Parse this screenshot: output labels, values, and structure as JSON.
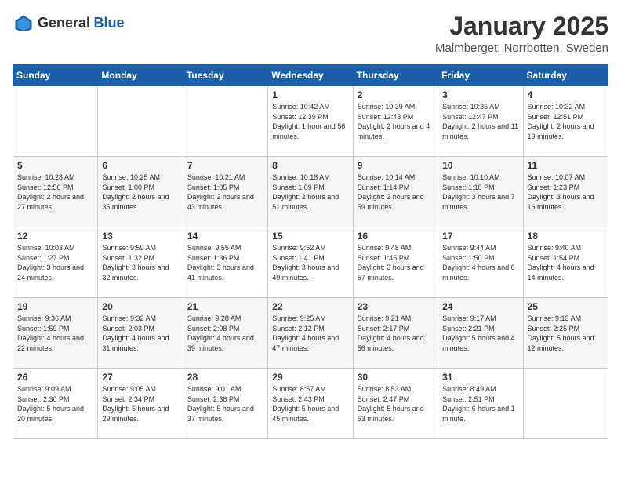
{
  "header": {
    "logo_general": "General",
    "logo_blue": "Blue",
    "title": "January 2025",
    "subtitle": "Malmberget, Norrbotten, Sweden"
  },
  "weekdays": [
    "Sunday",
    "Monday",
    "Tuesday",
    "Wednesday",
    "Thursday",
    "Friday",
    "Saturday"
  ],
  "weeks": [
    [
      {
        "day": "",
        "content": ""
      },
      {
        "day": "",
        "content": ""
      },
      {
        "day": "",
        "content": ""
      },
      {
        "day": "1",
        "content": "Sunrise: 10:42 AM\nSunset: 12:39 PM\nDaylight: 1 hour and 56 minutes."
      },
      {
        "day": "2",
        "content": "Sunrise: 10:39 AM\nSunset: 12:43 PM\nDaylight: 2 hours and 4 minutes."
      },
      {
        "day": "3",
        "content": "Sunrise: 10:35 AM\nSunset: 12:47 PM\nDaylight: 2 hours and 11 minutes."
      },
      {
        "day": "4",
        "content": "Sunrise: 10:32 AM\nSunset: 12:51 PM\nDaylight: 2 hours and 19 minutes."
      }
    ],
    [
      {
        "day": "5",
        "content": "Sunrise: 10:28 AM\nSunset: 12:56 PM\nDaylight: 2 hours and 27 minutes."
      },
      {
        "day": "6",
        "content": "Sunrise: 10:25 AM\nSunset: 1:00 PM\nDaylight: 2 hours and 35 minutes."
      },
      {
        "day": "7",
        "content": "Sunrise: 10:21 AM\nSunset: 1:05 PM\nDaylight: 2 hours and 43 minutes."
      },
      {
        "day": "8",
        "content": "Sunrise: 10:18 AM\nSunset: 1:09 PM\nDaylight: 2 hours and 51 minutes."
      },
      {
        "day": "9",
        "content": "Sunrise: 10:14 AM\nSunset: 1:14 PM\nDaylight: 2 hours and 59 minutes."
      },
      {
        "day": "10",
        "content": "Sunrise: 10:10 AM\nSunset: 1:18 PM\nDaylight: 3 hours and 7 minutes."
      },
      {
        "day": "11",
        "content": "Sunrise: 10:07 AM\nSunset: 1:23 PM\nDaylight: 3 hours and 16 minutes."
      }
    ],
    [
      {
        "day": "12",
        "content": "Sunrise: 10:03 AM\nSunset: 1:27 PM\nDaylight: 3 hours and 24 minutes."
      },
      {
        "day": "13",
        "content": "Sunrise: 9:59 AM\nSunset: 1:32 PM\nDaylight: 3 hours and 32 minutes."
      },
      {
        "day": "14",
        "content": "Sunrise: 9:55 AM\nSunset: 1:36 PM\nDaylight: 3 hours and 41 minutes."
      },
      {
        "day": "15",
        "content": "Sunrise: 9:52 AM\nSunset: 1:41 PM\nDaylight: 3 hours and 49 minutes."
      },
      {
        "day": "16",
        "content": "Sunrise: 9:48 AM\nSunset: 1:45 PM\nDaylight: 3 hours and 57 minutes."
      },
      {
        "day": "17",
        "content": "Sunrise: 9:44 AM\nSunset: 1:50 PM\nDaylight: 4 hours and 6 minutes."
      },
      {
        "day": "18",
        "content": "Sunrise: 9:40 AM\nSunset: 1:54 PM\nDaylight: 4 hours and 14 minutes."
      }
    ],
    [
      {
        "day": "19",
        "content": "Sunrise: 9:36 AM\nSunset: 1:59 PM\nDaylight: 4 hours and 22 minutes."
      },
      {
        "day": "20",
        "content": "Sunrise: 9:32 AM\nSunset: 2:03 PM\nDaylight: 4 hours and 31 minutes."
      },
      {
        "day": "21",
        "content": "Sunrise: 9:28 AM\nSunset: 2:08 PM\nDaylight: 4 hours and 39 minutes."
      },
      {
        "day": "22",
        "content": "Sunrise: 9:25 AM\nSunset: 2:12 PM\nDaylight: 4 hours and 47 minutes."
      },
      {
        "day": "23",
        "content": "Sunrise: 9:21 AM\nSunset: 2:17 PM\nDaylight: 4 hours and 56 minutes."
      },
      {
        "day": "24",
        "content": "Sunrise: 9:17 AM\nSunset: 2:21 PM\nDaylight: 5 hours and 4 minutes."
      },
      {
        "day": "25",
        "content": "Sunrise: 9:13 AM\nSunset: 2:25 PM\nDaylight: 5 hours and 12 minutes."
      }
    ],
    [
      {
        "day": "26",
        "content": "Sunrise: 9:09 AM\nSunset: 2:30 PM\nDaylight: 5 hours and 20 minutes."
      },
      {
        "day": "27",
        "content": "Sunrise: 9:05 AM\nSunset: 2:34 PM\nDaylight: 5 hours and 29 minutes."
      },
      {
        "day": "28",
        "content": "Sunrise: 9:01 AM\nSunset: 2:38 PM\nDaylight: 5 hours and 37 minutes."
      },
      {
        "day": "29",
        "content": "Sunrise: 8:57 AM\nSunset: 2:43 PM\nDaylight: 5 hours and 45 minutes."
      },
      {
        "day": "30",
        "content": "Sunrise: 8:53 AM\nSunset: 2:47 PM\nDaylight: 5 hours and 53 minutes."
      },
      {
        "day": "31",
        "content": "Sunrise: 8:49 AM\nSunset: 2:51 PM\nDaylight: 6 hours and 1 minute."
      },
      {
        "day": "",
        "content": ""
      }
    ]
  ]
}
